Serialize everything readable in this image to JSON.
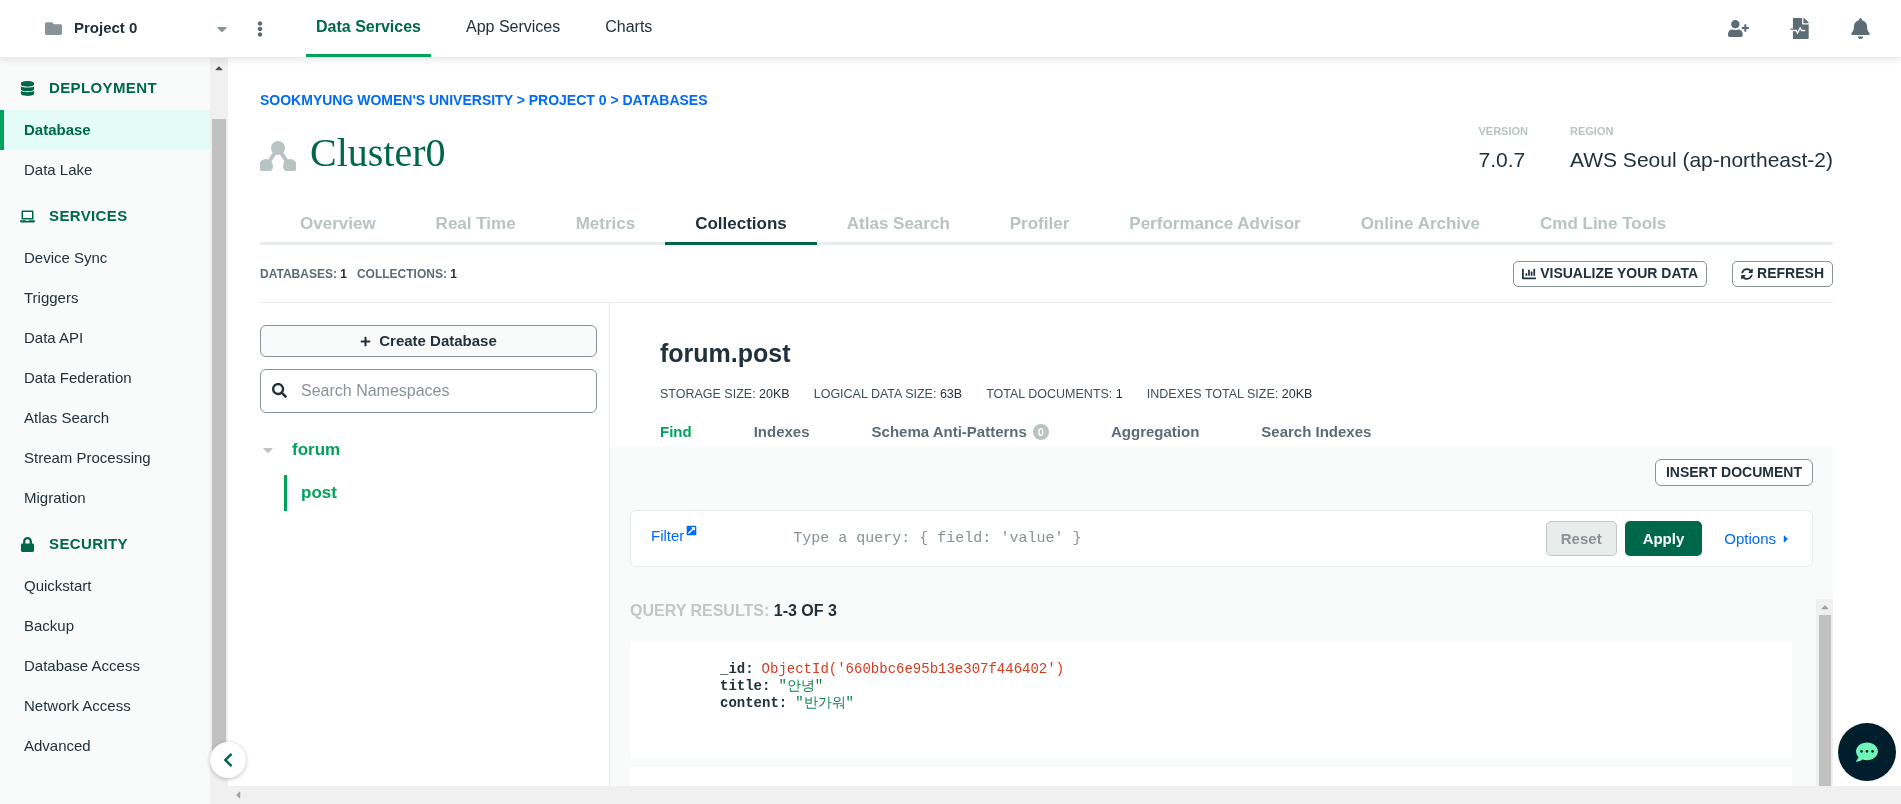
{
  "top_bar": {
    "project": "Project 0",
    "tabs": [
      {
        "label": "Data Services",
        "selected": true
      },
      {
        "label": "App Services",
        "selected": false
      },
      {
        "label": "Charts",
        "selected": false
      }
    ]
  },
  "sidebar": {
    "sections": [
      {
        "kind": "database",
        "title": "DEPLOYMENT",
        "items": [
          {
            "label": "Database",
            "selected": true
          },
          {
            "label": "Data Lake",
            "selected": false
          }
        ]
      },
      {
        "kind": "services",
        "title": "SERVICES",
        "items": [
          {
            "label": "Device Sync",
            "selected": false
          },
          {
            "label": "Triggers",
            "selected": false
          },
          {
            "label": "Data API",
            "selected": false
          },
          {
            "label": "Data Federation",
            "selected": false
          },
          {
            "label": "Atlas Search",
            "selected": false
          },
          {
            "label": "Stream Processing",
            "selected": false
          },
          {
            "label": "Migration",
            "selected": false
          }
        ]
      },
      {
        "kind": "security",
        "title": "SECURITY",
        "items": [
          {
            "label": "Quickstart",
            "selected": false
          },
          {
            "label": "Backup",
            "selected": false
          },
          {
            "label": "Database Access",
            "selected": false
          },
          {
            "label": "Network Access",
            "selected": false
          },
          {
            "label": "Advanced",
            "selected": false
          }
        ]
      }
    ]
  },
  "breadcrumb": "SOOKMYUNG WOMEN'S UNIVERSITY > PROJECT 0 > DATABASES",
  "cluster": {
    "name": "Cluster0",
    "info": [
      {
        "label": "VERSION",
        "value": "7.0.7"
      },
      {
        "label": "REGION",
        "value": "AWS Seoul (ap-northeast-2)"
      }
    ]
  },
  "cluster_tabs": [
    {
      "label": "Overview",
      "selected": false
    },
    {
      "label": "Real Time",
      "selected": false
    },
    {
      "label": "Metrics",
      "selected": false
    },
    {
      "label": "Collections",
      "selected": true
    },
    {
      "label": "Atlas Search",
      "selected": false
    },
    {
      "label": "Profiler",
      "selected": false
    },
    {
      "label": "Performance Advisor",
      "selected": false
    },
    {
      "label": "Online Archive",
      "selected": false
    },
    {
      "label": "Cmd Line Tools",
      "selected": false
    }
  ],
  "counts": [
    {
      "label": "DATABASES:",
      "value": "1"
    },
    {
      "label": "COLLECTIONS:",
      "value": "1"
    }
  ],
  "actions": [
    {
      "kind": "chart",
      "label": "VISUALIZE YOUR DATA"
    },
    {
      "kind": "refresh",
      "label": "REFRESH"
    }
  ],
  "namespaces": {
    "create_button": "Create Database",
    "search": {
      "placeholder": "Search Namespaces"
    },
    "tree": [
      {
        "label": "forum",
        "expanded": true,
        "children": [
          {
            "label": "post",
            "selected": true
          }
        ]
      }
    ]
  },
  "collection": {
    "name": "forum.post",
    "stats": [
      {
        "label": "STORAGE SIZE:",
        "value": "20KB"
      },
      {
        "label": "LOGICAL DATA SIZE:",
        "value": "63B"
      },
      {
        "label": "TOTAL DOCUMENTS:",
        "value": "1"
      },
      {
        "label": "INDEXES TOTAL SIZE:",
        "value": "20KB"
      }
    ],
    "tabs": [
      {
        "label": "Find",
        "selected": true
      },
      {
        "label": "Indexes",
        "selected": false
      },
      {
        "label": "Schema Anti-Patterns",
        "selected": false,
        "badge": "0"
      },
      {
        "label": "Aggregation",
        "selected": false
      },
      {
        "label": "Search Indexes",
        "selected": false
      }
    ],
    "insert_button": "INSERT DOCUMENT",
    "filter": {
      "label": "Filter",
      "placeholder": "Type a query: { field: 'value' }",
      "reset": "Reset",
      "apply": "Apply",
      "options": "Options"
    },
    "results_label": "QUERY RESULTS:",
    "results_range": "1-3 OF 3",
    "documents": [
      {
        "fields": [
          {
            "key": "_id:",
            "value": "ObjectId('660bbc6e95b13e307f446402')",
            "kind": "objectid"
          },
          {
            "key": "title:",
            "value": "\"안녕\"",
            "kind": "string"
          },
          {
            "key": "content:",
            "value": "\"반가워\"",
            "kind": "string"
          }
        ]
      }
    ]
  }
}
